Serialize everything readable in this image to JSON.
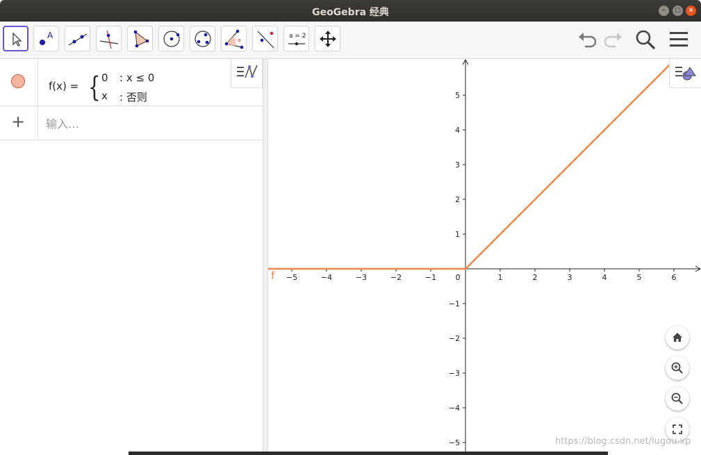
{
  "window": {
    "title": "GeoGebra 经典"
  },
  "toolbar": {
    "tools": [
      {
        "name": "move-tool"
      },
      {
        "name": "point-tool"
      },
      {
        "name": "line-tool"
      },
      {
        "name": "perpendicular-tool"
      },
      {
        "name": "polygon-tool"
      },
      {
        "name": "circle-tool"
      },
      {
        "name": "conic-tool"
      },
      {
        "name": "angle-tool"
      },
      {
        "name": "reflect-tool"
      },
      {
        "name": "slider-tool",
        "label": "a = 2"
      },
      {
        "name": "move-view-tool"
      }
    ]
  },
  "algebra": {
    "function": {
      "lhs": "f(x)  =",
      "case1_value": "0",
      "case1_cond": ": x ≤ 0",
      "case2_value": "x",
      "case2_cond": ": 否则",
      "color": "#f5b59e"
    },
    "input_placeholder": "输入…"
  },
  "graphics": {
    "function_label": "f",
    "function_color": "#f5874c",
    "x_ticks": [
      "-5",
      "-4",
      "-3",
      "-2",
      "-1",
      "0",
      "1",
      "2",
      "3",
      "4",
      "5",
      "6"
    ],
    "y_ticks": [
      "5",
      "4",
      "3",
      "2",
      "1",
      "-1",
      "-2",
      "-3",
      "-4",
      "-5"
    ]
  },
  "watermark": "https://blog.csdn.net/lugou.xp"
}
